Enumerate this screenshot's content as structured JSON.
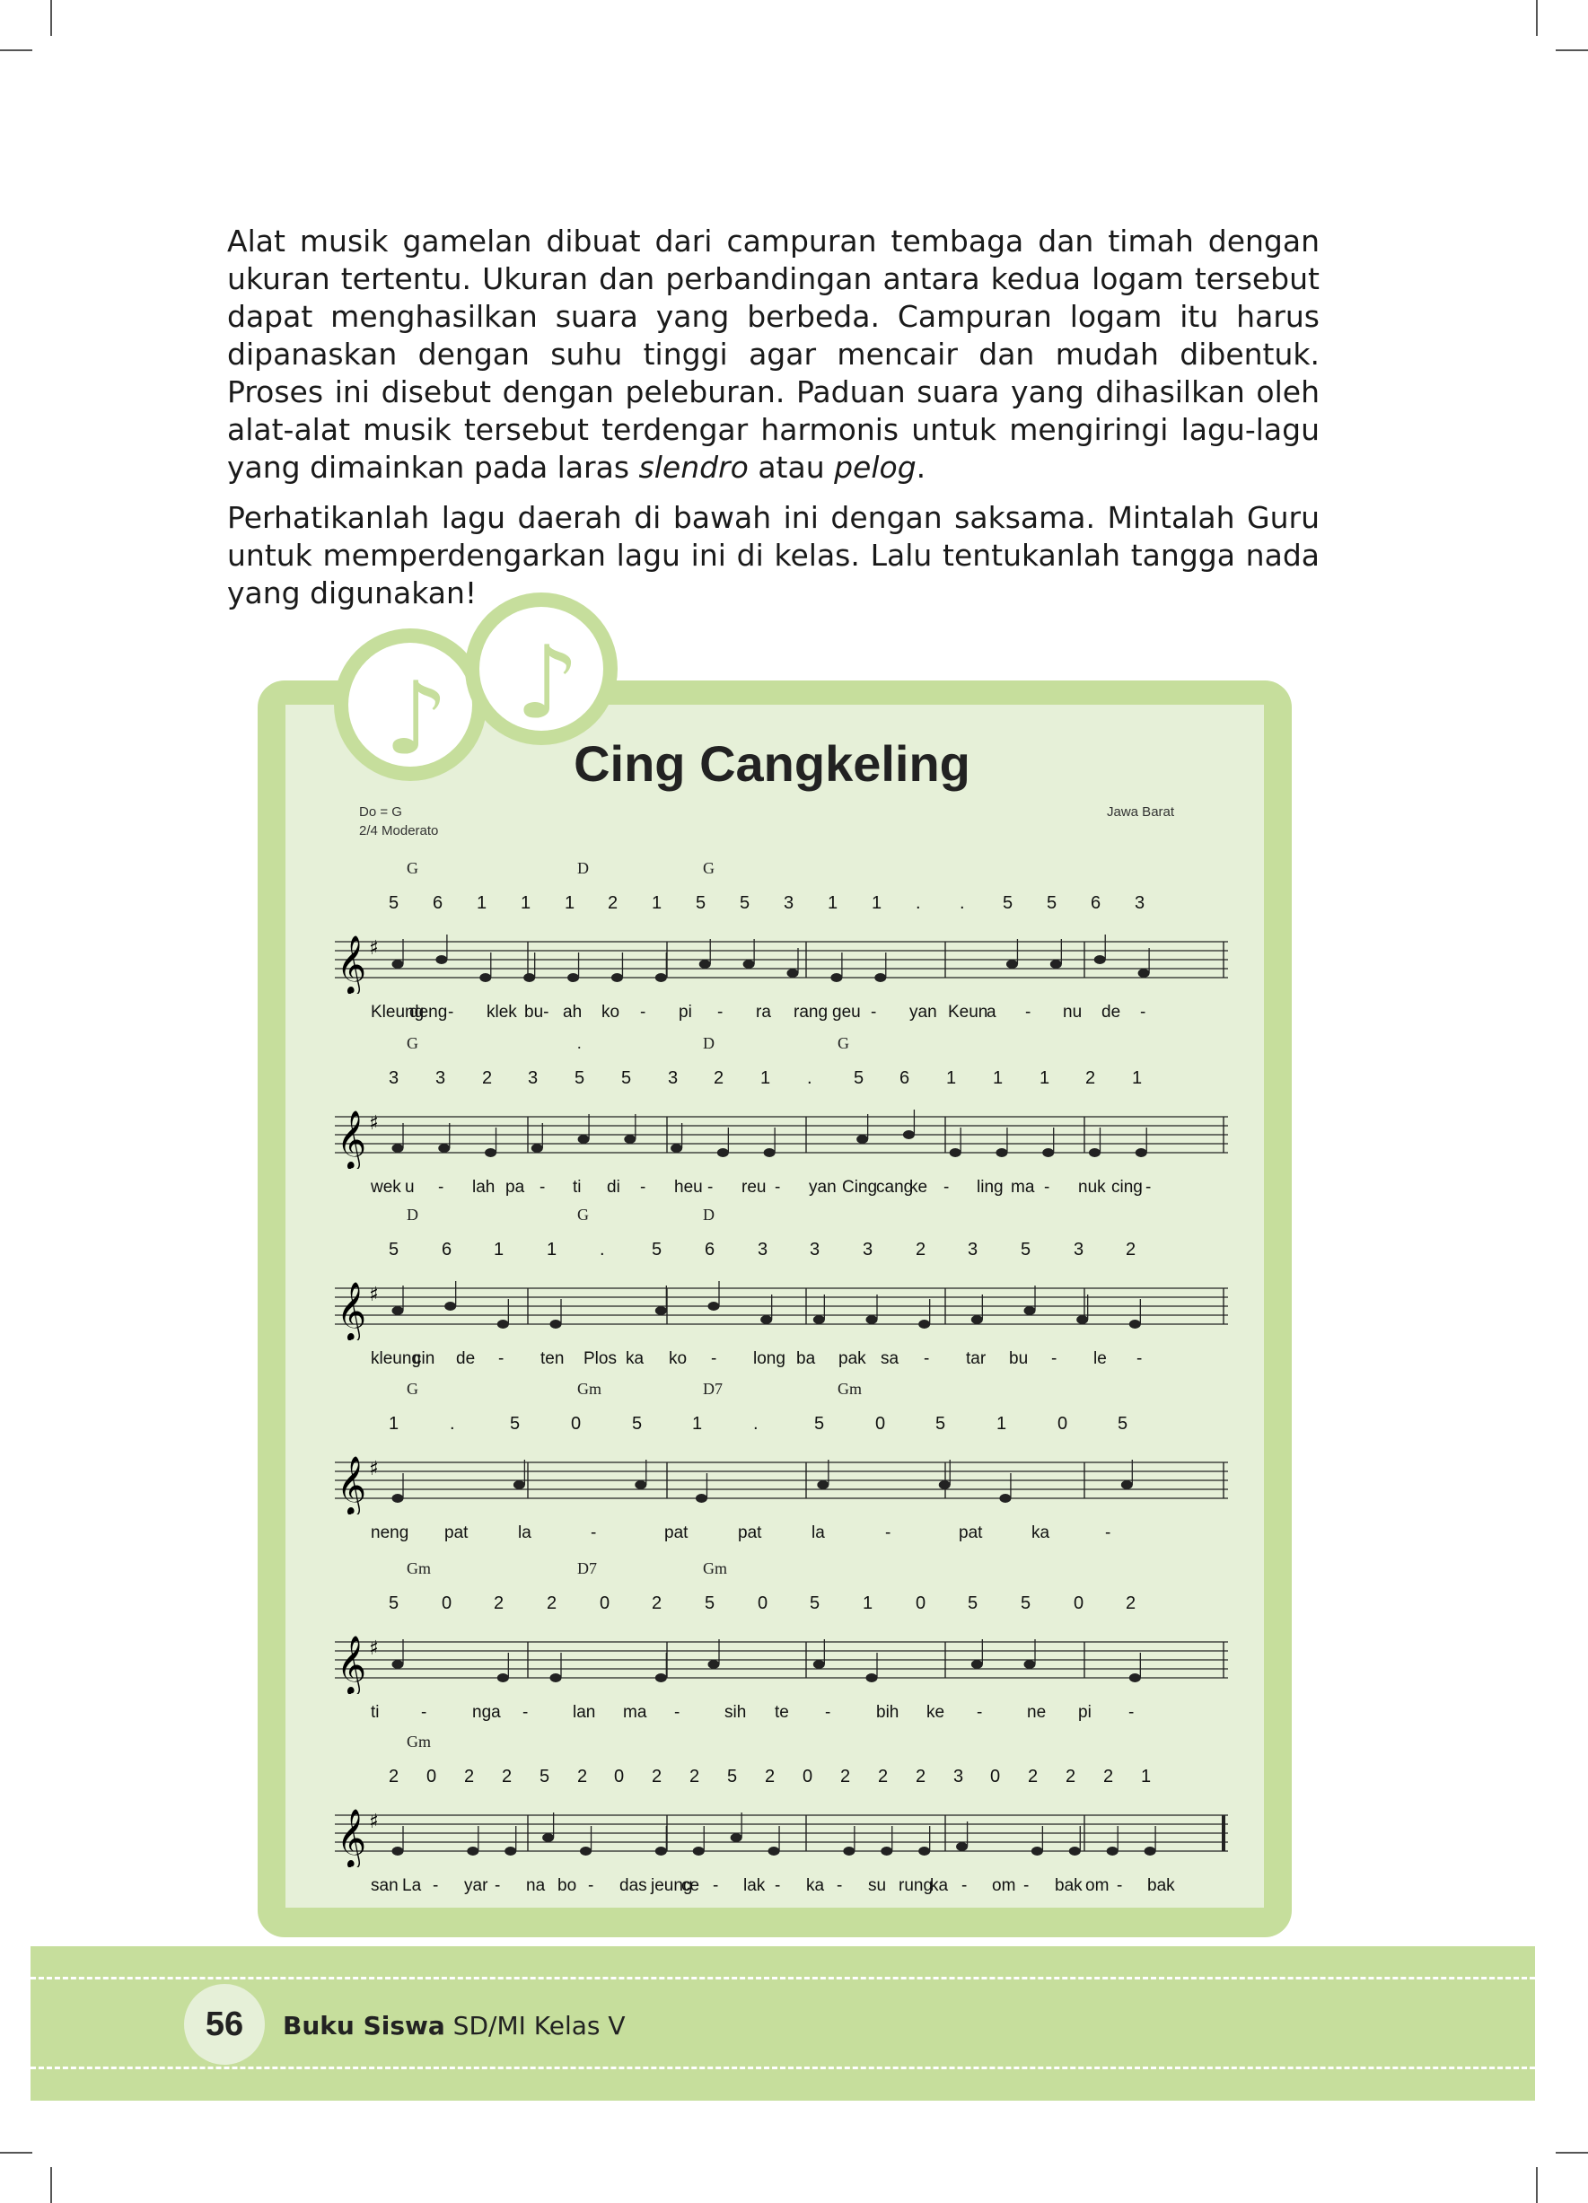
{
  "body_text": {
    "p1_text": "Alat musik gamelan dibuat dari campuran tembaga dan timah dengan ukuran tertentu. Ukuran dan perbandingan antara kedua logam tersebut dapat menghasilkan suara yang berbeda. Campuran logam itu harus dipanaskan dengan suhu tinggi agar mencair dan mudah dibentuk. Proses ini disebut dengan peleburan. Paduan suara yang dihasilkan oleh alat-alat musik tersebut terdengar harmonis untuk mengiringi lagu-lagu yang dimainkan pada laras",
    "p1_em1": "slendro",
    "p1_mid": " atau ",
    "p1_em2": "pelog",
    "p1_end": ".",
    "p2": "Perhatikanlah lagu daerah di bawah ini dengan saksama. Mintalah Guru untuk memperdengarkan lagu ini di kelas. Lalu tentukanlah tangga nada yang digunakan!"
  },
  "song": {
    "note_icon": "music-note-icon",
    "note_glyph": "♪",
    "title": "Cing Cangkeling",
    "key": "Do = G",
    "tempo": "2/4 Moderato",
    "origin": "Jawa Barat",
    "rows": [
      {
        "chords": [
          "G",
          "D",
          "G"
        ],
        "numbers": [
          "5",
          "6",
          "1",
          "1",
          "1",
          "2",
          "1",
          "5",
          "5",
          "3",
          "1",
          "1",
          ".",
          ".",
          "5",
          "5",
          "6",
          "3"
        ],
        "lyrics": [
          "Kleung",
          "deng",
          "-",
          "klek",
          "bu-",
          "ah",
          "ko",
          "-",
          "pi",
          "-",
          "ra",
          "rang",
          "geu",
          "-",
          "yan",
          "Keun",
          "a",
          "-",
          "nu",
          "de",
          "-"
        ]
      },
      {
        "chords": [
          "G",
          ".",
          "D",
          "G"
        ],
        "numbers": [
          "3",
          "3",
          "2",
          "3",
          "5",
          "5",
          "3",
          "2",
          "1",
          ".",
          "5",
          "6",
          "1",
          "1",
          "1",
          "2",
          "1"
        ],
        "lyrics": [
          "wek",
          "u",
          "-",
          "lah",
          "pa",
          "-",
          "ti",
          "di",
          "-",
          "heu",
          "-",
          "reu",
          "-",
          "yan",
          "Cing",
          "cang",
          "ke",
          "-",
          "ling",
          "ma",
          "-",
          "nuk",
          "cing",
          "-"
        ]
      },
      {
        "chords": [
          "D",
          "G",
          "D"
        ],
        "numbers": [
          "5",
          "6",
          "1",
          "1",
          ".",
          "5",
          "6",
          "3",
          "3",
          "3",
          "2",
          "3",
          "5",
          "3",
          "2"
        ],
        "lyrics": [
          "kleung",
          "cin",
          "de",
          "-",
          "ten",
          "Plos",
          "ka",
          "ko",
          "-",
          "long",
          "ba",
          "pak",
          "sa",
          "-",
          "tar",
          "bu",
          "-",
          "le",
          "-"
        ]
      },
      {
        "chords": [
          "G",
          "Gm",
          "D7",
          "Gm"
        ],
        "numbers": [
          "1",
          ".",
          "5",
          "0",
          "5",
          "1",
          ".",
          "5",
          "0",
          "5",
          "1",
          "0",
          "5"
        ],
        "lyrics": [
          "neng",
          "pat",
          "la",
          "-",
          "pat",
          "pat",
          "la",
          "-",
          "pat",
          "ka",
          "-"
        ]
      },
      {
        "chords": [
          "Gm",
          "D7",
          "Gm"
        ],
        "numbers": [
          "5",
          "0",
          "2",
          "2",
          "0",
          "2",
          "5",
          "0",
          "5",
          "1",
          "0",
          "5",
          "5",
          "0",
          "2"
        ],
        "lyrics": [
          "ti",
          "-",
          "nga",
          "-",
          "lan",
          "ma",
          "-",
          "sih",
          "te",
          "-",
          "bih",
          "ke",
          "-",
          "ne",
          "pi",
          "-"
        ]
      },
      {
        "chords": [
          "Gm"
        ],
        "numbers": [
          "2",
          "0",
          "2",
          "2",
          "5",
          "2",
          "0",
          "2",
          "2",
          "5",
          "2",
          "0",
          "2",
          "2",
          "2",
          "3",
          "0",
          "2",
          "2",
          "2",
          "1"
        ],
        "lyrics": [
          "san",
          "La",
          "-",
          "yar",
          "-",
          "na",
          "bo",
          "-",
          "das",
          "jeung",
          "ce",
          "-",
          "lak",
          "-",
          "ka",
          "-",
          "su",
          "rung",
          "ka",
          "-",
          "om",
          "-",
          "bak",
          "om",
          "-",
          "bak"
        ]
      }
    ]
  },
  "footer": {
    "page_number": "56",
    "book_bold": "Buku Siswa",
    "book_rest": " SD/MI Kelas V"
  }
}
